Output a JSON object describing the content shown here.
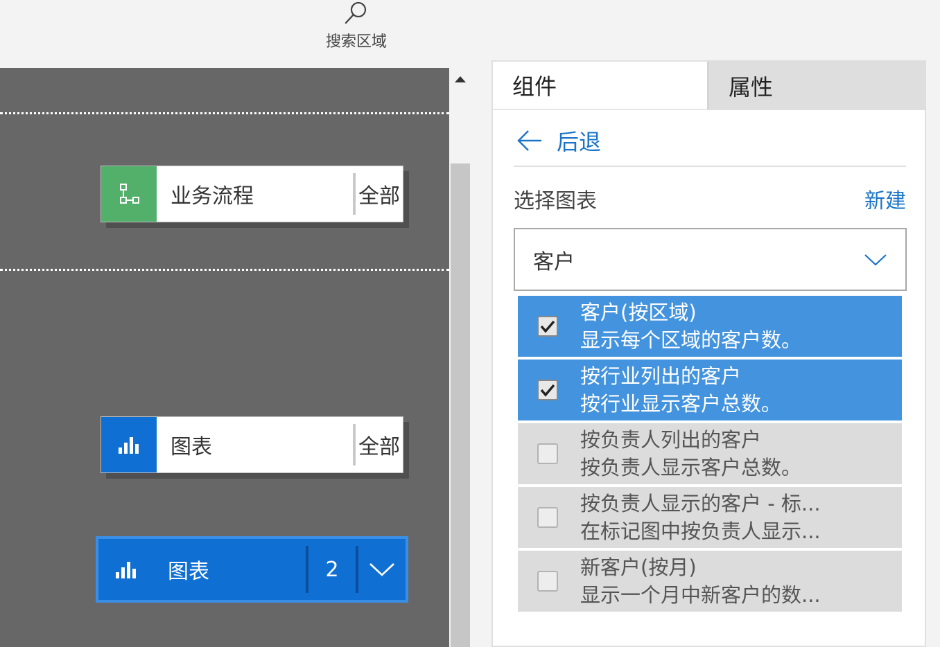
{
  "search": {
    "label": "搜索区域"
  },
  "canvas": {
    "nodes": [
      {
        "label": "业务流程",
        "end": "全部",
        "icon": "process-icon",
        "color": "#52b06a"
      },
      {
        "label": "图表",
        "end": "全部",
        "icon": "chart-icon",
        "color": "#0f6fd3"
      },
      {
        "label": "图表",
        "count": "2",
        "icon": "chart-icon",
        "color": "#0f6fd3",
        "selected": true
      }
    ]
  },
  "panel": {
    "tabs": [
      {
        "label": "组件",
        "active": true
      },
      {
        "label": "属性",
        "active": false
      }
    ],
    "back_label": "后退",
    "select_label": "选择图表",
    "new_label": "新建",
    "dropdown_value": "客户",
    "charts": [
      {
        "title": "客户(按区域)",
        "desc": "显示每个区域的客户数。",
        "checked": true
      },
      {
        "title": "按行业列出的客户",
        "desc": "按行业显示客户总数。",
        "checked": true
      },
      {
        "title": "按负责人列出的客户",
        "desc": "按负责人显示客户总数。",
        "checked": false
      },
      {
        "title": "按负责人显示的客户 - 标...",
        "desc": "在标记图中按负责人显示...",
        "checked": false
      },
      {
        "title": "新客户(按月)",
        "desc": "显示一个月中新客户的数...",
        "checked": false
      }
    ]
  },
  "colors": {
    "accent": "#0f6fd3",
    "link": "#1a74c8",
    "selected_row": "#4393de",
    "process": "#52b06a",
    "canvas": "#676767"
  }
}
